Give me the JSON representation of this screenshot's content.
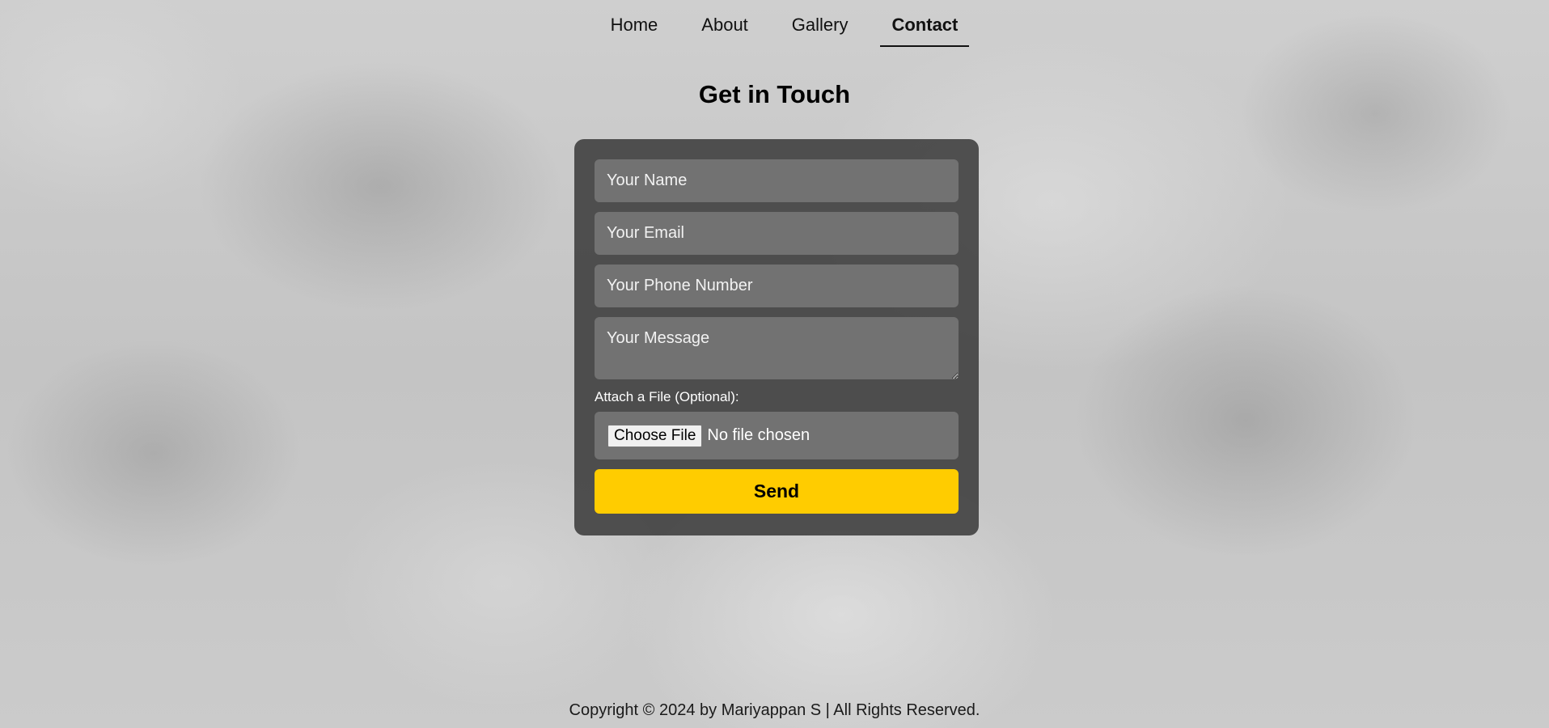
{
  "nav": {
    "items": [
      {
        "label": "Home"
      },
      {
        "label": "About"
      },
      {
        "label": "Gallery"
      },
      {
        "label": "Contact"
      }
    ],
    "active": "Contact"
  },
  "page": {
    "title": "Get in Touch"
  },
  "form": {
    "name_placeholder": "Your Name",
    "email_placeholder": "Your Email",
    "phone_placeholder": "Your Phone Number",
    "message_placeholder": "Your Message",
    "file_label": "Attach a File (Optional):",
    "file_button": "Choose File",
    "file_status": "No file chosen",
    "submit_label": "Send"
  },
  "footer": {
    "text": "Copyright © 2024 by Mariyappan S | All Rights Reserved."
  },
  "colors": {
    "accent": "#ffcc00",
    "card": "#3c3c3c"
  }
}
